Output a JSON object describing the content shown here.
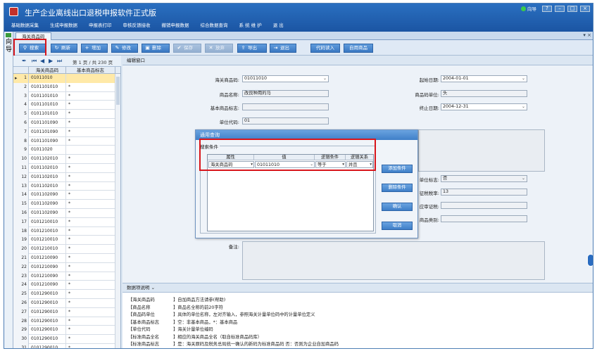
{
  "app": {
    "title": "生产企业离线出口退税申报软件正式版",
    "nav_label": "向导"
  },
  "menu": [
    "基础数据采集",
    "生成申报数据",
    "申报表打印",
    "审核反馈接收",
    "撤销申报数据",
    "综合数据查询",
    "系 统 维 护",
    "退 出"
  ],
  "left_strip_text": "向导",
  "tab": {
    "label": "海关商品码"
  },
  "toolbar": {
    "search": "搜索",
    "refresh": "刷新",
    "add": "增加",
    "edit": "修改",
    "delete": "删除",
    "save": "保存",
    "cancel": "放弃",
    "export": "导出",
    "exit": "退出",
    "code_import": "代码读入",
    "custom_product": "自用商品"
  },
  "pager": {
    "text": "第 1 页 / 共 230 页"
  },
  "grid": {
    "columns": [
      "海关商品码",
      "基本商品标志"
    ],
    "rows": [
      {
        "n": "1",
        "code": "01011010",
        "flag": ""
      },
      {
        "n": "2",
        "code": "0101101010",
        "flag": "*"
      },
      {
        "n": "3",
        "code": "0101101010",
        "flag": "*"
      },
      {
        "n": "4",
        "code": "0101101010",
        "flag": "*"
      },
      {
        "n": "5",
        "code": "0101101010",
        "flag": "*"
      },
      {
        "n": "6",
        "code": "0101101090",
        "flag": "*"
      },
      {
        "n": "7",
        "code": "0101101090",
        "flag": "*"
      },
      {
        "n": "8",
        "code": "0101101090",
        "flag": "*"
      },
      {
        "n": "9",
        "code": "01011020",
        "flag": ""
      },
      {
        "n": "10",
        "code": "0101102010",
        "flag": "*"
      },
      {
        "n": "11",
        "code": "0101102010",
        "flag": "*"
      },
      {
        "n": "12",
        "code": "0101102010",
        "flag": "*"
      },
      {
        "n": "13",
        "code": "0101102010",
        "flag": "*"
      },
      {
        "n": "14",
        "code": "0101102090",
        "flag": "*"
      },
      {
        "n": "15",
        "code": "0101102090",
        "flag": "*"
      },
      {
        "n": "16",
        "code": "0101102090",
        "flag": "*"
      },
      {
        "n": "17",
        "code": "0101210010",
        "flag": "*"
      },
      {
        "n": "18",
        "code": "0101210010",
        "flag": "*"
      },
      {
        "n": "19",
        "code": "0101210010",
        "flag": "*"
      },
      {
        "n": "20",
        "code": "0101210010",
        "flag": "*"
      },
      {
        "n": "21",
        "code": "0101210090",
        "flag": "*"
      },
      {
        "n": "22",
        "code": "0101210090",
        "flag": "*"
      },
      {
        "n": "23",
        "code": "0101210090",
        "flag": "*"
      },
      {
        "n": "24",
        "code": "0101210090",
        "flag": "*"
      },
      {
        "n": "25",
        "code": "0101290010",
        "flag": "*"
      },
      {
        "n": "26",
        "code": "0101290010",
        "flag": "*"
      },
      {
        "n": "27",
        "code": "0101290010",
        "flag": "*"
      },
      {
        "n": "28",
        "code": "0101290010",
        "flag": "*"
      },
      {
        "n": "29",
        "code": "0101290010",
        "flag": "*"
      },
      {
        "n": "30",
        "code": "0101290010",
        "flag": "*"
      },
      {
        "n": "31",
        "code": "0101290010",
        "flag": "*"
      }
    ]
  },
  "edit_panel": {
    "title": "编辑窗口",
    "fields": {
      "hs_code_label": "海关商品码:",
      "hs_code_value": "01011010",
      "product_name_label": "商品名称:",
      "product_name_value": "改良种用的马",
      "basic_flag_label": "基本商品标志:",
      "basic_flag_value": "",
      "unit_code_label": "单位代码:",
      "unit_code_value": "01",
      "start_date_label": "起始日期:",
      "start_date_value": "2004-01-01",
      "product_unit_label": "商品码单位:",
      "product_unit_value": "头",
      "end_date_label": "终止日期:",
      "end_date_value": "2004-12-31",
      "unit_flag_label": "单位标志:",
      "unit_flag_value": "否",
      "levy_rate_label": "征税税率:",
      "levy_rate_value": "13",
      "refund_proof_label": "应审证税:",
      "refund_proof_value": "",
      "category_label": "商品类别:",
      "category_value": "",
      "remark_label": "备注:"
    }
  },
  "help": {
    "title": "数据项说明",
    "lines": [
      {
        "k": "【海关商品码",
        "v": "】自加商品方法请参(帮助)"
      },
      {
        "k": "【商品名称",
        "v": "】商品名全称的前20字符"
      },
      {
        "k": "【商品码单位",
        "v": "】具体的单位名称，左对齐输入，参照海关计量单位码中的计量单位定义"
      },
      {
        "k": "【基本商品标志",
        "v": "】空：非基本商品，*：基本商品"
      },
      {
        "k": "【单位代码",
        "v": "】海关计量单位编码"
      },
      {
        "k": "【标准商品全名",
        "v": "】相应的海关商品全名（取自标准商品码库）"
      },
      {
        "k": "【标准商品标志",
        "v": "】是：海关原码及税务总局统一确认的新码为标准商品码 否：否则为企业自加商品码"
      }
    ]
  },
  "dialog": {
    "title": "通用查询",
    "group_label": "搜索条件",
    "columns": [
      "属性",
      "值",
      "逻辑条件",
      "逻辑关系"
    ],
    "row": {
      "attr": "海关商品码",
      "value": "01011010",
      "cond": "等于",
      "rel": "并且"
    },
    "buttons": {
      "add": "添加条件",
      "remove": "删除条件",
      "confirm": "确认",
      "cancel": "取消"
    }
  },
  "colors": {
    "title_bar": "#1b55a3",
    "toolbar_button": "#3a78c2",
    "highlight_box": "#d8151b",
    "selected_row": "#ffe9a8"
  }
}
